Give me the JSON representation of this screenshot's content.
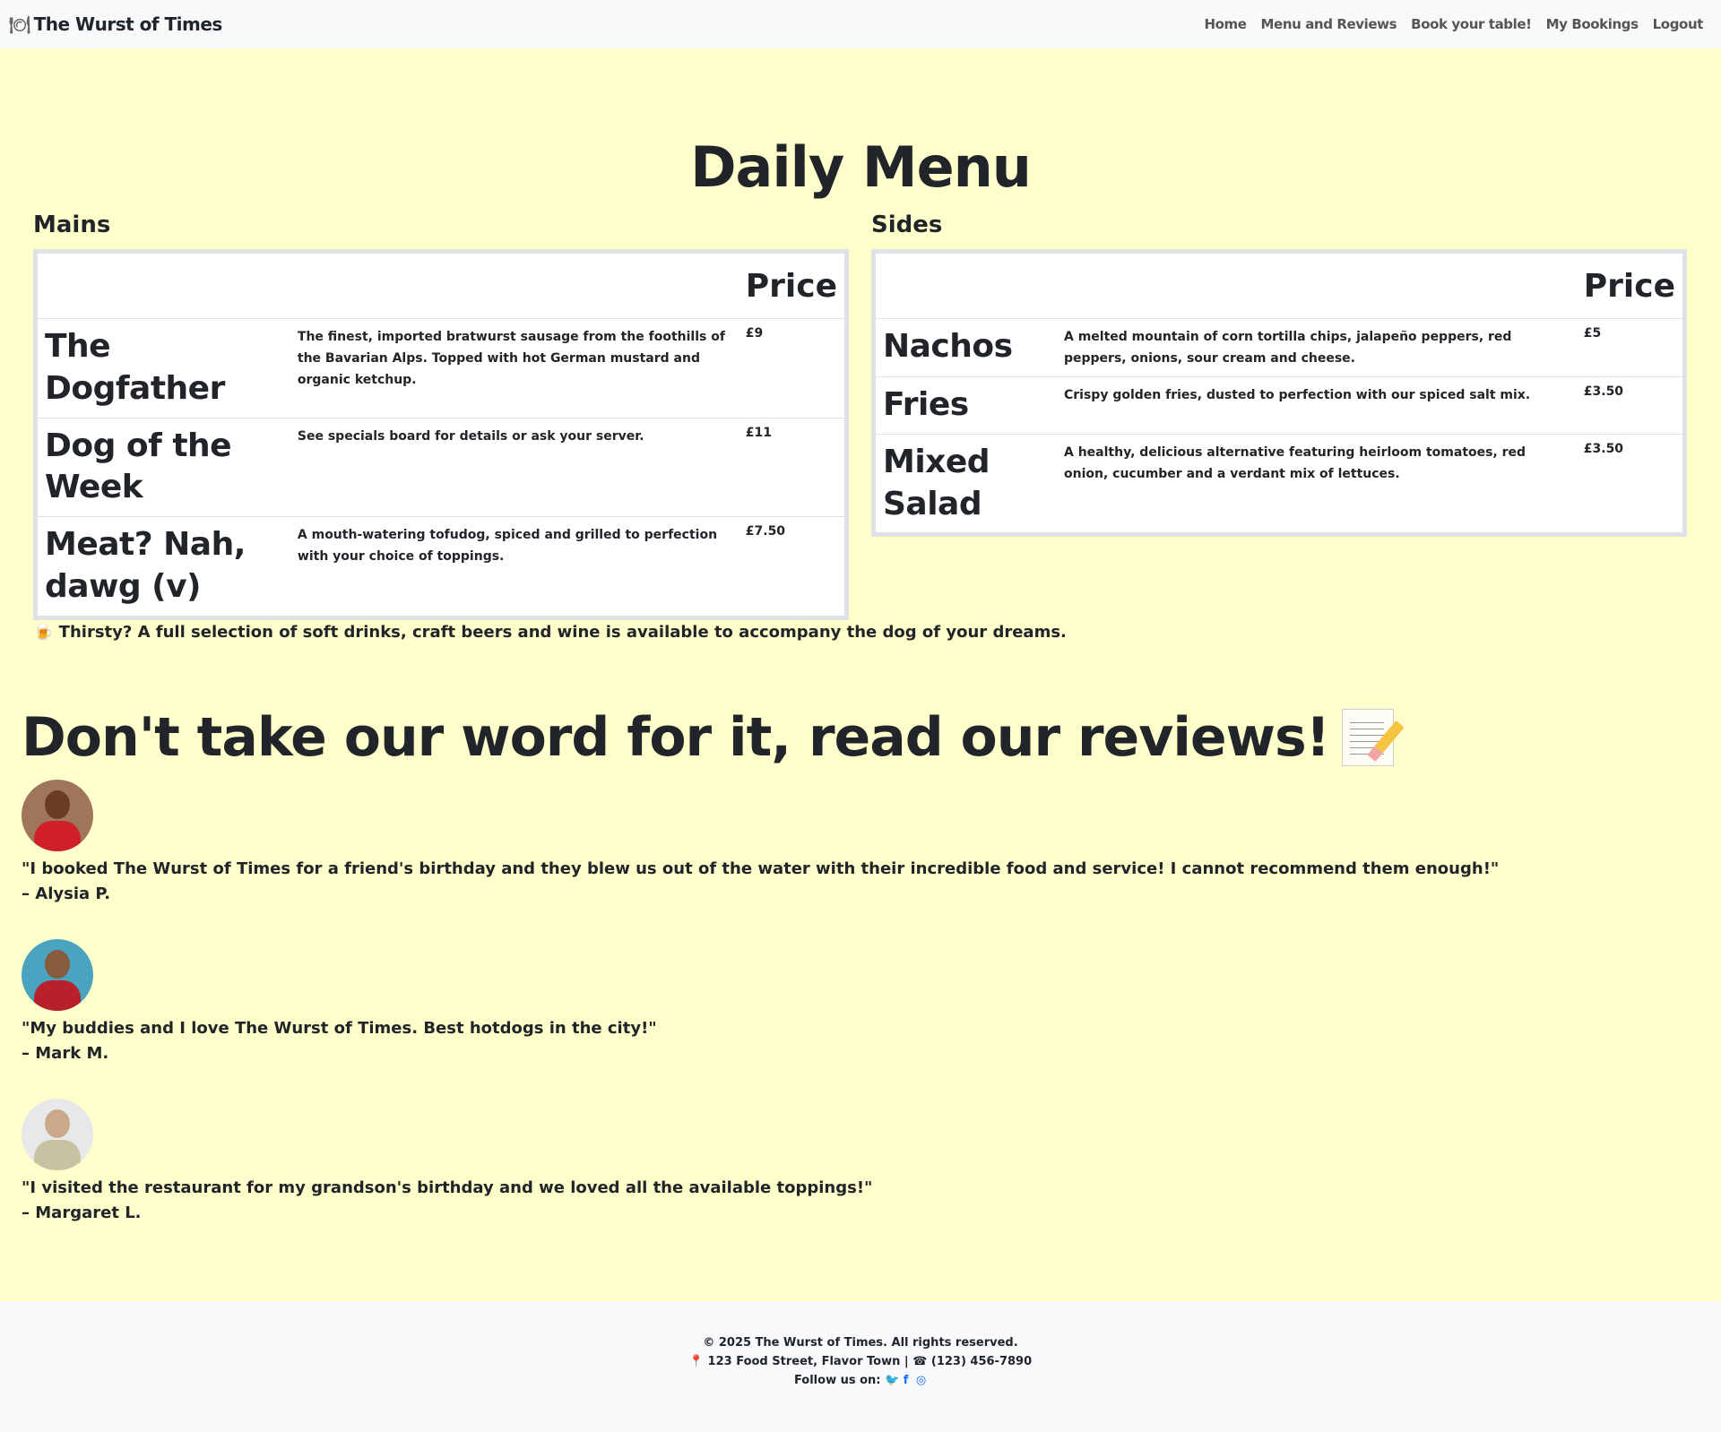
{
  "nav": {
    "brand": "The Wurst of Times",
    "brand_icon": "plate-cutlery-icon",
    "links": [
      "Home",
      "Menu and Reviews",
      "Book your table!",
      "My Bookings",
      "Logout"
    ]
  },
  "menu": {
    "title": "Daily Menu",
    "mains": {
      "label": "Mains",
      "price_header": "Price",
      "items": [
        {
          "name": "The Dogfather",
          "desc": "The finest, imported bratwurst sausage from the foothills of the Bavarian Alps. Topped with hot German mustard and organic ketchup.",
          "price": "£9"
        },
        {
          "name": "Dog of the Week",
          "desc": "See specials board for details or ask your server.",
          "price": "£11"
        },
        {
          "name": "Meat? Nah, dawg (v)",
          "desc": "A mouth-watering tofudog, spiced and grilled to perfection with your choice of toppings.",
          "price": "£7.50"
        }
      ]
    },
    "sides": {
      "label": "Sides",
      "price_header": "Price",
      "items": [
        {
          "name": "Nachos",
          "desc": "A melted mountain of corn tortilla chips, jalapeño peppers, red peppers, onions, sour cream and cheese.",
          "price": "£5"
        },
        {
          "name": "Fries",
          "desc": "Crispy golden fries, dusted to perfection with our spiced salt mix.",
          "price": "£3.50"
        },
        {
          "name": "Mixed Salad",
          "desc": "A healthy, delicious alternative featuring heirloom tomatoes, red onion, cucumber and a verdant mix of lettuces.",
          "price": "£3.50"
        }
      ]
    },
    "drinks_note": "🍺 Thirsty? A full selection of soft drinks, craft beers and wine is available to accompany the dog of your dreams."
  },
  "reviews": {
    "title": "Don't take our word for it, read our reviews!",
    "title_icon": "memo-icon",
    "items": [
      {
        "quote": "\"I booked The Wurst of Times for a friend's birthday and they blew us out of the water with their incredible food and service! I cannot recommend them enough!\"",
        "author": "– Alysia P."
      },
      {
        "quote": "\"My buddies and I love The Wurst of Times. Best hotdogs in the city!\"",
        "author": "– Mark M."
      },
      {
        "quote": "\"I visited the restaurant for my grandson's birthday and we loved all the available toppings!\"",
        "author": "– Margaret L."
      }
    ]
  },
  "footer": {
    "copyright": "© 2025 The Wurst of Times. All rights reserved.",
    "address": "📍 123 Food Street, Flavor Town | ☎ (123) 456-7890",
    "follow": "Follow us on:",
    "social_icons": [
      "twitter-icon",
      "facebook-icon",
      "instagram-icon"
    ]
  }
}
